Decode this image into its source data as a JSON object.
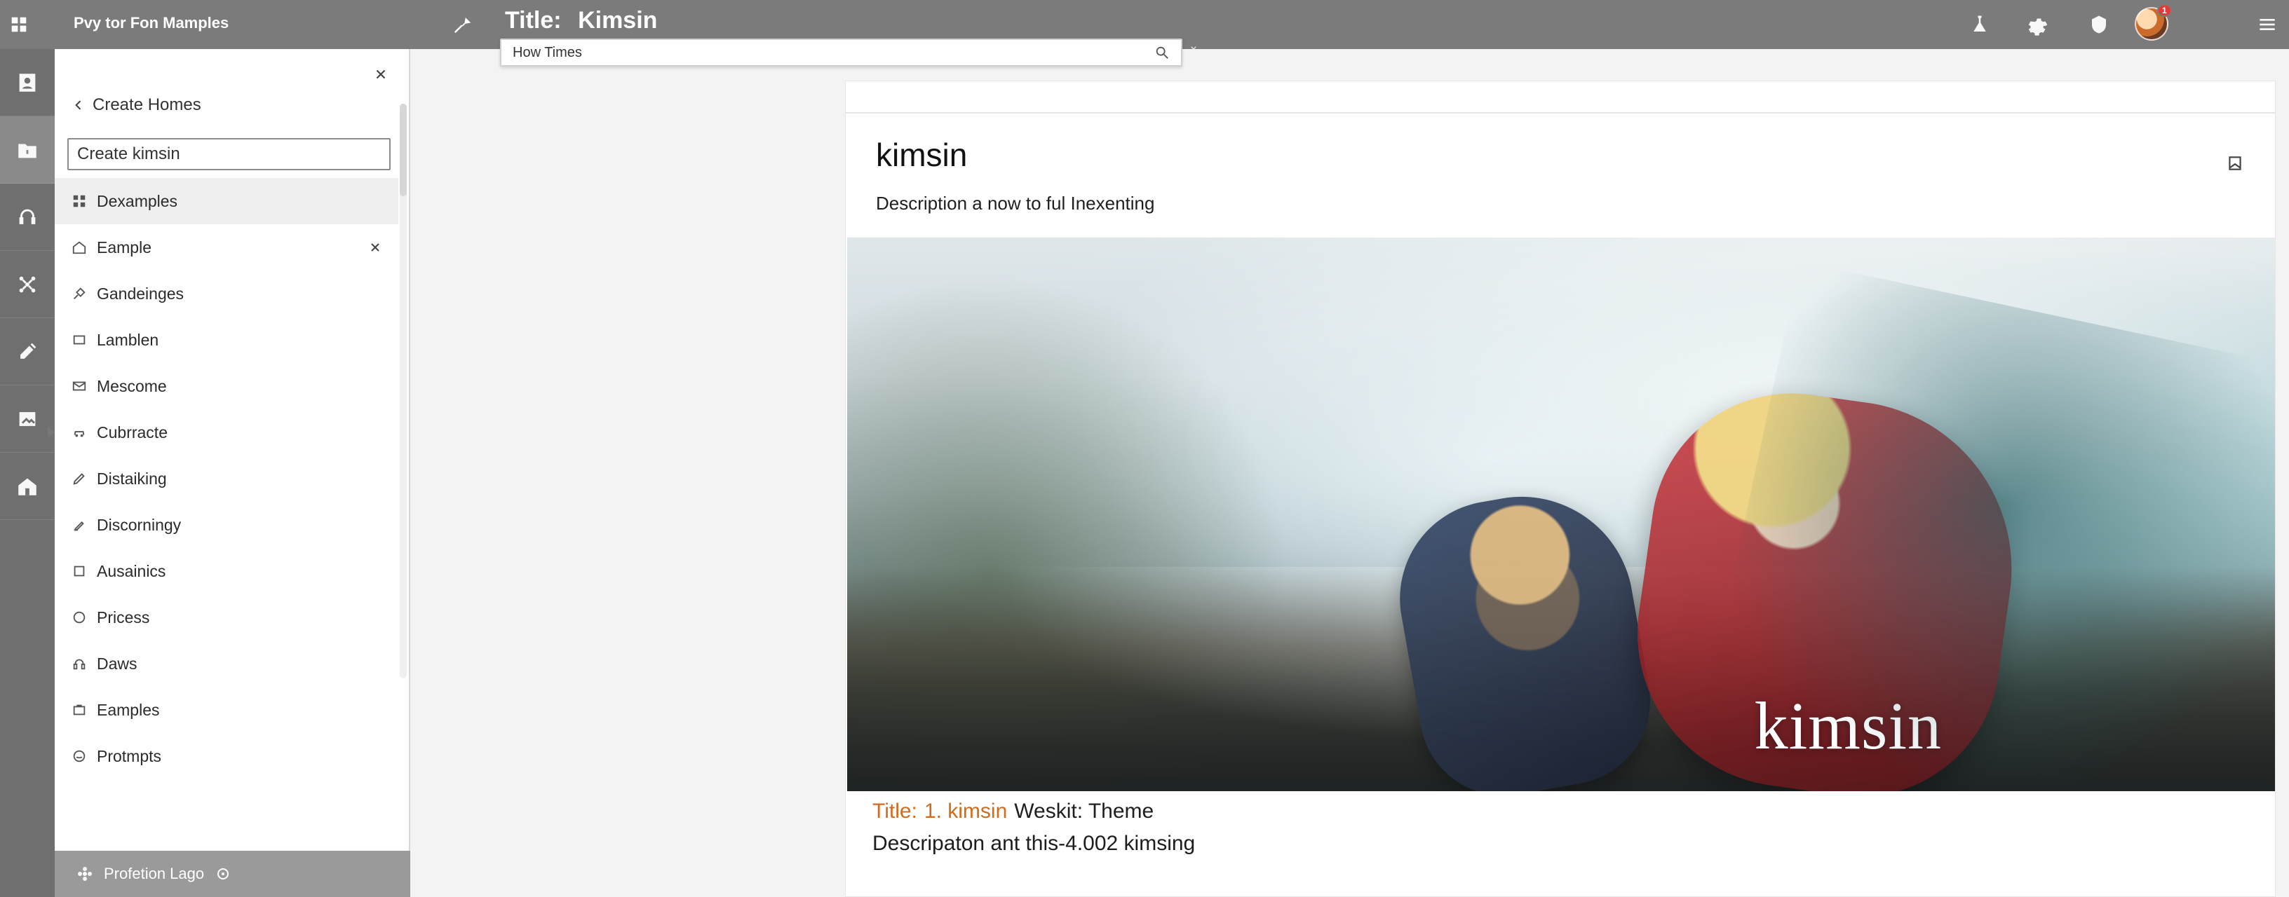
{
  "colors": {
    "topbar": "#7b7b7b",
    "rail": "#6f6f6f",
    "accent": "#d26b1d"
  },
  "app": {
    "title": "Pvy tor Fon Mamples"
  },
  "page": {
    "title_label": "Title:",
    "title_value": "Kimsin"
  },
  "search": {
    "value": "How Times",
    "icon": "search-icon"
  },
  "topbar": {
    "icons": [
      "flask-icon",
      "gear-icon",
      "shield-icon",
      "avatar-icon",
      "menu-icon"
    ],
    "notification_count": "1"
  },
  "sidebar": {
    "back_label": "Create Homes",
    "search_value": "Create kimsin",
    "items": [
      {
        "label": "Dexamples",
        "icon": "grid-icon",
        "active": true
      },
      {
        "label": "Eample",
        "icon": "home-icon",
        "active": false,
        "has_close": true
      },
      {
        "label": "Gandeinges",
        "icon": "brush-icon",
        "active": false
      },
      {
        "label": "Lamblen",
        "icon": "rectangle-icon",
        "active": false
      },
      {
        "label": "Mescome",
        "icon": "mail-icon",
        "active": false
      },
      {
        "label": "Cubrracte",
        "icon": "car-icon",
        "active": false,
        "marker": true
      },
      {
        "label": "Distaiking",
        "icon": "pen-icon",
        "active": false
      },
      {
        "label": "Discorningy",
        "icon": "pencil-icon",
        "active": false
      },
      {
        "label": "Ausainics",
        "icon": "square-icon",
        "active": false
      },
      {
        "label": "Pricess",
        "icon": "circle-icon",
        "active": false
      },
      {
        "label": "Daws",
        "icon": "headphones-icon",
        "active": false
      },
      {
        "label": "Eamples",
        "icon": "briefcase-icon",
        "active": false
      },
      {
        "label": "Protmpts",
        "icon": "smile-icon",
        "active": false
      }
    ],
    "footer": {
      "label": "Profetion Lago",
      "left_icon": "flower-icon",
      "right_icon": "settings-icon"
    }
  },
  "main": {
    "card": {
      "title": "kimsin",
      "description": "Description a now to ful Inexenting",
      "bookmark_icon": "bookmark-icon",
      "hero_logo_text": "kimsin",
      "meta": {
        "line1_label": "Title:",
        "line1_accent": "1. kimsin",
        "line1_rest": "Weskit: Theme",
        "line2": "Descripaton ant this-4.002 kimsing"
      }
    }
  }
}
